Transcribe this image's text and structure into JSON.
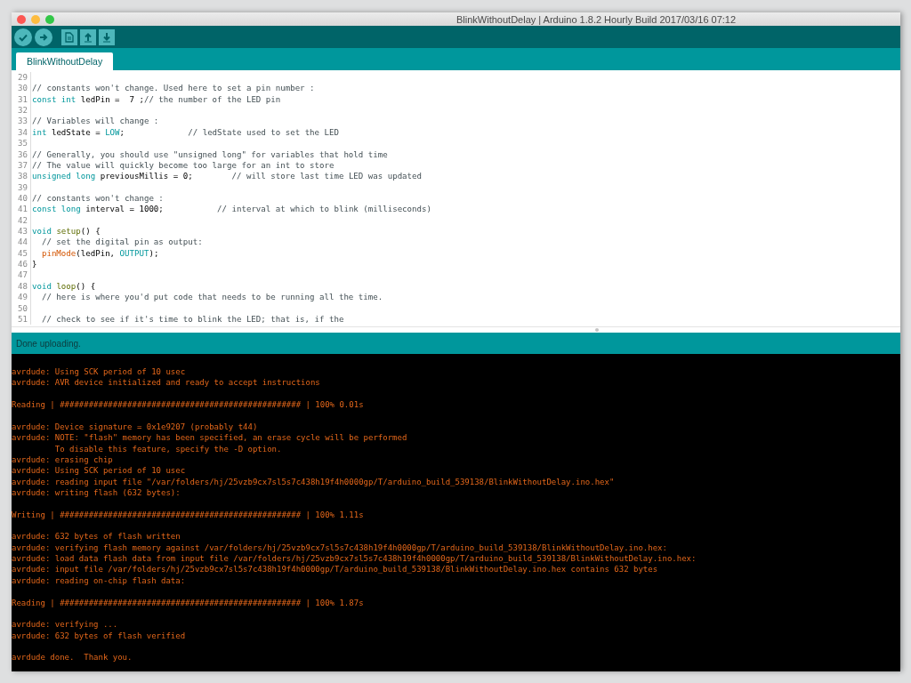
{
  "window": {
    "title": "BlinkWithoutDelay | Arduino 1.8.2 Hourly Build 2017/03/16 07:12"
  },
  "tabs": [
    {
      "label": "BlinkWithoutDelay",
      "selected": true
    }
  ],
  "editor": {
    "lines": [
      {
        "number": "29"
      },
      {
        "number": "30",
        "tokens": [
          {
            "kind": "comment",
            "text": "// constants won't change. Used here to set a pin number :"
          }
        ]
      },
      {
        "number": "31",
        "tokens": [
          {
            "kind": "keyword",
            "text": "const"
          },
          {
            "kind": "keyword",
            "text": " int"
          },
          {
            "kind": "plain",
            "text": " ledPin =  7 ;"
          },
          {
            "kind": "comment",
            "text": "// the number of the LED pin"
          }
        ]
      },
      {
        "number": "32"
      },
      {
        "number": "33",
        "tokens": [
          {
            "kind": "comment",
            "text": "// Variables will change :"
          }
        ]
      },
      {
        "number": "34",
        "tokens": [
          {
            "kind": "keyword",
            "text": "int"
          },
          {
            "kind": "plain",
            "text": " ledState = "
          },
          {
            "kind": "constant",
            "text": "LOW"
          },
          {
            "kind": "plain",
            "text": ";             "
          },
          {
            "kind": "comment",
            "text": "// ledState used to set the LED"
          }
        ]
      },
      {
        "number": "35"
      },
      {
        "number": "36",
        "tokens": [
          {
            "kind": "comment",
            "text": "// Generally, you should use \"unsigned long\" for variables that hold time"
          }
        ]
      },
      {
        "number": "37",
        "tokens": [
          {
            "kind": "comment",
            "text": "// The value will quickly become too large for an int to store"
          }
        ]
      },
      {
        "number": "38",
        "tokens": [
          {
            "kind": "keyword",
            "text": "unsigned"
          },
          {
            "kind": "keyword",
            "text": " long"
          },
          {
            "kind": "plain",
            "text": " previousMillis = 0;        "
          },
          {
            "kind": "comment",
            "text": "// will store last time LED was updated"
          }
        ]
      },
      {
        "number": "39"
      },
      {
        "number": "40",
        "tokens": [
          {
            "kind": "comment",
            "text": "// constants won't change :"
          }
        ]
      },
      {
        "number": "41",
        "tokens": [
          {
            "kind": "keyword",
            "text": "const"
          },
          {
            "kind": "keyword",
            "text": " long"
          },
          {
            "kind": "plain",
            "text": " interval = 1000;           "
          },
          {
            "kind": "comment",
            "text": "// interval at which to blink (milliseconds)"
          }
        ]
      },
      {
        "number": "42"
      },
      {
        "number": "43",
        "tokens": [
          {
            "kind": "keyword",
            "text": "void"
          },
          {
            "kind": "structure",
            "text": " setup"
          },
          {
            "kind": "plain",
            "text": "() {"
          }
        ]
      },
      {
        "number": "44",
        "tokens": [
          {
            "kind": "comment",
            "text": "  // set the digital pin as output:"
          }
        ]
      },
      {
        "number": "45",
        "tokens": [
          {
            "kind": "function",
            "text": "  pinMode"
          },
          {
            "kind": "plain",
            "text": "(ledPin, "
          },
          {
            "kind": "constant",
            "text": "OUTPUT"
          },
          {
            "kind": "plain",
            "text": ");"
          }
        ]
      },
      {
        "number": "46",
        "tokens": [
          {
            "kind": "plain",
            "text": "}"
          }
        ]
      },
      {
        "number": "47"
      },
      {
        "number": "48",
        "tokens": [
          {
            "kind": "keyword",
            "text": "void"
          },
          {
            "kind": "structure",
            "text": " loop"
          },
          {
            "kind": "plain",
            "text": "() {"
          }
        ]
      },
      {
        "number": "49",
        "tokens": [
          {
            "kind": "comment",
            "text": "  // here is where you'd put code that needs to be running all the time."
          }
        ]
      },
      {
        "number": "50"
      },
      {
        "number": "51",
        "tokens": [
          {
            "kind": "comment",
            "text": "  // check to see if it's time to blink the LED; that is, if the"
          }
        ]
      }
    ]
  },
  "status": {
    "message": "Done uploading."
  },
  "console": {
    "blocks": [
      [
        "avrdude: Using SCK period of 10 usec",
        "avrdude: AVR device initialized and ready to accept instructions"
      ],
      [
        "Reading | ################################################## | 100% 0.01s"
      ],
      [
        "avrdude: Device signature = 0x1e9207 (probably t44)",
        "avrdude: NOTE: \"flash\" memory has been specified, an erase cycle will be performed",
        "         To disable this feature, specify the -D option.",
        "avrdude: erasing chip",
        "avrdude: Using SCK period of 10 usec",
        "avrdude: reading input file \"/var/folders/hj/25vzb9cx7sl5s7c438h19f4h0000gp/T/arduino_build_539138/BlinkWithoutDelay.ino.hex\"",
        "avrdude: writing flash (632 bytes):"
      ],
      [
        "Writing | ################################################## | 100% 1.11s"
      ],
      [
        "avrdude: 632 bytes of flash written",
        "avrdude: verifying flash memory against /var/folders/hj/25vzb9cx7sl5s7c438h19f4h0000gp/T/arduino_build_539138/BlinkWithoutDelay.ino.hex:",
        "avrdude: load data flash data from input file /var/folders/hj/25vzb9cx7sl5s7c438h19f4h0000gp/T/arduino_build_539138/BlinkWithoutDelay.ino.hex:",
        "avrdude: input file /var/folders/hj/25vzb9cx7sl5s7c438h19f4h0000gp/T/arduino_build_539138/BlinkWithoutDelay.ino.hex contains 632 bytes",
        "avrdude: reading on-chip flash data:"
      ],
      [
        "Reading | ################################################## | 100% 1.87s"
      ],
      [
        "avrdude: verifying ...",
        "avrdude: 632 bytes of flash verified"
      ],
      [
        "avrdude done.  Thank you."
      ]
    ]
  }
}
